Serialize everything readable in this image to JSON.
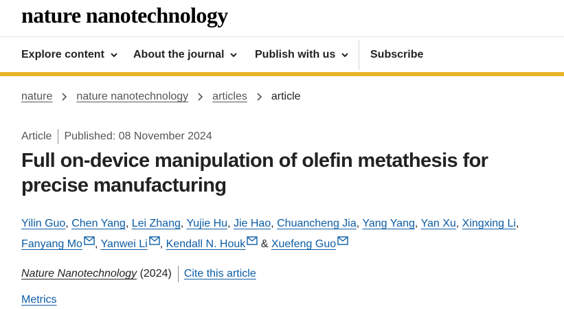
{
  "header": {
    "logo_text": "nature nanotechnology"
  },
  "nav": {
    "items": [
      {
        "label": "Explore content",
        "has_dropdown": true
      },
      {
        "label": "About the journal",
        "has_dropdown": true
      },
      {
        "label": "Publish with us",
        "has_dropdown": true
      },
      {
        "label": "Subscribe",
        "has_dropdown": false
      }
    ]
  },
  "breadcrumb": [
    "nature",
    "nature nanotechnology",
    "articles",
    "article"
  ],
  "article": {
    "type": "Article",
    "published": "Published: 08 November 2024",
    "title_line1": "Full on-device manipulation of olefin metathesis for",
    "title_line2": "precise manufacturing",
    "authors": [
      "Yilin Guo",
      "Chen Yang",
      "Lei Zhang",
      "Yujie Hu",
      "Jie Hao",
      "Chuancheng Jia",
      "Yang Yang",
      "Yan Xu",
      "Xingxing Li",
      "Fanyang Mo",
      "Yanwei Li",
      "Kendall N. Houk",
      "Xuefeng Guo"
    ],
    "journal": "Nature Nanotechnology",
    "year": "(2024)",
    "cite_label": "Cite this article",
    "metrics_label": "Metrics"
  },
  "icons": {
    "dropdown": "chevron-down-icon",
    "separator": "chevron-right-icon",
    "email": "envelope-icon"
  },
  "colors": {
    "accent_bar": "#e6b428",
    "link": "#0c5da5",
    "text": "#222222",
    "muted": "#555555"
  }
}
